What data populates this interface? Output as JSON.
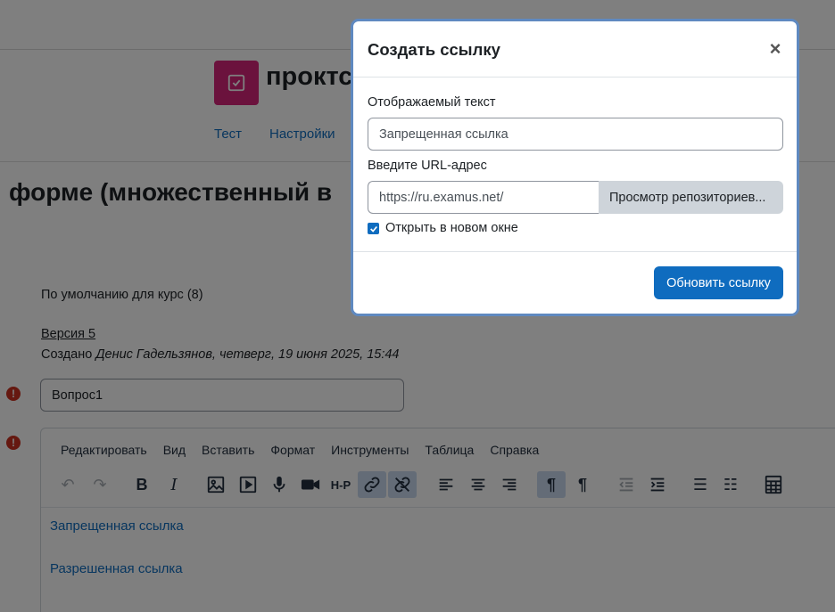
{
  "course": {
    "title": "проктс",
    "nav": [
      "Тест",
      "Настройки"
    ]
  },
  "page": {
    "heading": "форме (множественный в"
  },
  "question": {
    "category": "По умолчанию для курс (8)",
    "version_link": "Версия 5",
    "created_prefix": "Создано ",
    "created_by": "Денис Гадельзянов, четверг, 19 июня 2025, 15:44",
    "name_value": "Вопрос1",
    "error_glyph": "!"
  },
  "editor": {
    "menu": [
      "Редактировать",
      "Вид",
      "Вставить",
      "Формат",
      "Инструменты",
      "Таблица",
      "Справка"
    ],
    "toolbar": {
      "undo": "↶",
      "redo": "↷",
      "bold": "B",
      "italic": "I",
      "h5p": "H-P",
      "ltr": "¶",
      "rtl": "¶",
      "bullet_list": "☰",
      "numbered_list": "☷"
    },
    "content_links": [
      "Запрещенная ссылка",
      "Разрешенная ссылка"
    ]
  },
  "modal": {
    "title": "Создать ссылку",
    "close_glyph": "×",
    "display_text_label": "Отображаемый текст",
    "display_text_value": "Запрещенная ссылка",
    "url_label": "Введите URL-адрес",
    "url_value": "https://ru.examus.net/",
    "browse_button": "Просмотр репозиториев...",
    "new_window_label": "Открыть в новом окне",
    "new_window_checked": true,
    "submit_button": "Обновить ссылку"
  },
  "colors": {
    "accent": "#0f6cbf",
    "course_icon": "#d6247b",
    "error": "#ca3120",
    "active_tool": "#c8d9ee"
  }
}
